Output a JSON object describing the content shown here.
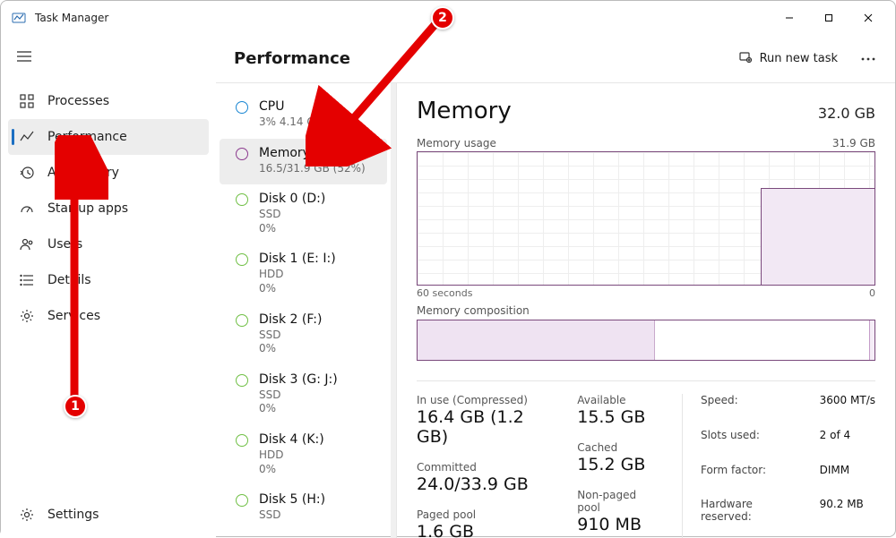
{
  "window": {
    "title": "Task Manager"
  },
  "nav": [
    {
      "label": "Processes"
    },
    {
      "label": "Performance"
    },
    {
      "label": "App history"
    },
    {
      "label": "Startup apps"
    },
    {
      "label": "Users"
    },
    {
      "label": "Details"
    },
    {
      "label": "Services"
    }
  ],
  "nav_settings": "Settings",
  "header": {
    "title": "Performance",
    "run_task": "Run new task"
  },
  "perf_items": [
    {
      "name": "CPU",
      "sub1": "3% 4.14 GHz",
      "sub2": "",
      "ring": "#1986d2"
    },
    {
      "name": "Memory",
      "sub1": "16.5/31.9 GB (52%)",
      "sub2": "",
      "ring": "#8b3a8e"
    },
    {
      "name": "Disk 0 (D:)",
      "sub1": "SSD",
      "sub2": "0%",
      "ring": "#6fbf44"
    },
    {
      "name": "Disk 1 (E: I:)",
      "sub1": "HDD",
      "sub2": "0%",
      "ring": "#6fbf44"
    },
    {
      "name": "Disk 2 (F:)",
      "sub1": "SSD",
      "sub2": "0%",
      "ring": "#6fbf44"
    },
    {
      "name": "Disk 3 (G: J:)",
      "sub1": "SSD",
      "sub2": "0%",
      "ring": "#6fbf44"
    },
    {
      "name": "Disk 4 (K:)",
      "sub1": "HDD",
      "sub2": "0%",
      "ring": "#6fbf44"
    },
    {
      "name": "Disk 5 (H:)",
      "sub1": "SSD",
      "sub2": "",
      "ring": "#6fbf44"
    }
  ],
  "detail": {
    "title": "Memory",
    "capacity": "32.0 GB",
    "usage_label": "Memory usage",
    "usage_cap": "31.9 GB",
    "axis_left": "60 seconds",
    "axis_right": "0",
    "comp_label": "Memory composition",
    "stats": {
      "in_use_label": "In use (Compressed)",
      "in_use": "16.4 GB (1.2 GB)",
      "available_label": "Available",
      "available": "15.5 GB",
      "committed_label": "Committed",
      "committed": "24.0/33.9 GB",
      "cached_label": "Cached",
      "cached": "15.2 GB",
      "paged_label": "Paged pool",
      "paged": "1.6 GB",
      "nonpaged_label": "Non-paged pool",
      "nonpaged": "910 MB"
    },
    "meta": {
      "speed_k": "Speed:",
      "speed_v": "3600 MT/s",
      "slots_k": "Slots used:",
      "slots_v": "2 of 4",
      "form_k": "Form factor:",
      "form_v": "DIMM",
      "hw_k": "Hardware reserved:",
      "hw_v": "90.2 MB"
    }
  },
  "annotations": {
    "b1": "1",
    "b2": "2"
  },
  "chart_data": {
    "type": "line",
    "title": "Memory usage",
    "xlabel": "60 seconds → 0",
    "ylabel": "GB",
    "ylim": [
      0,
      31.9
    ],
    "series": [
      {
        "name": "In use",
        "values_note": "recent samples ≈ 23 GB (only rightmost ~25% of window populated)"
      }
    ]
  }
}
